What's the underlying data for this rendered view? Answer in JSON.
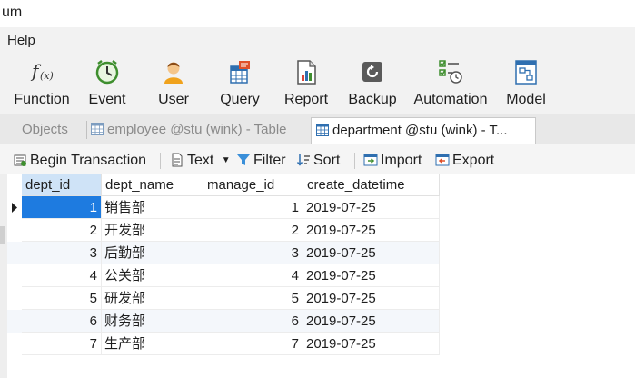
{
  "window": {
    "title": "um"
  },
  "menu": {
    "help": "Help"
  },
  "ribbon": [
    {
      "id": "function",
      "label": "Function",
      "icon": "function-icon"
    },
    {
      "id": "event",
      "label": "Event",
      "icon": "clock-icon"
    },
    {
      "id": "user",
      "label": "User",
      "icon": "user-icon"
    },
    {
      "id": "query",
      "label": "Query",
      "icon": "query-table-icon"
    },
    {
      "id": "report",
      "label": "Report",
      "icon": "report-icon"
    },
    {
      "id": "backup",
      "label": "Backup",
      "icon": "backup-icon"
    },
    {
      "id": "automation",
      "label": "Automation",
      "icon": "checklist-clock-icon"
    },
    {
      "id": "model",
      "label": "Model",
      "icon": "model-icon"
    }
  ],
  "tabs": [
    {
      "label": "Objects",
      "active": false
    },
    {
      "label": "employee @stu (wink) - Table",
      "active": false
    },
    {
      "label": "department @stu (wink) - T...",
      "active": true
    }
  ],
  "toolbar": {
    "begin_transaction": "Begin Transaction",
    "text": "Text",
    "filter": "Filter",
    "sort": "Sort",
    "import": "Import",
    "export": "Export"
  },
  "table": {
    "columns": [
      "dept_id",
      "dept_name",
      "manage_id",
      "create_datetime"
    ],
    "rows": [
      {
        "dept_id": "1",
        "dept_name": "销售部",
        "manage_id": "1",
        "create_datetime": "2019-07-25"
      },
      {
        "dept_id": "2",
        "dept_name": "开发部",
        "manage_id": "2",
        "create_datetime": "2019-07-25"
      },
      {
        "dept_id": "3",
        "dept_name": "后勤部",
        "manage_id": "3",
        "create_datetime": "2019-07-25"
      },
      {
        "dept_id": "4",
        "dept_name": "公关部",
        "manage_id": "4",
        "create_datetime": "2019-07-25"
      },
      {
        "dept_id": "5",
        "dept_name": "研发部",
        "manage_id": "5",
        "create_datetime": "2019-07-25"
      },
      {
        "dept_id": "6",
        "dept_name": "财务部",
        "manage_id": "6",
        "create_datetime": "2019-07-25"
      },
      {
        "dept_id": "7",
        "dept_name": "生产部",
        "manage_id": "7",
        "create_datetime": "2019-07-25"
      }
    ],
    "selected_row": 1
  },
  "colors": {
    "selected_cell": "#1e7be0",
    "header_selected": "#cfe3f7",
    "alt_row": "#f4f7fb",
    "accent": "#3a7fc1"
  }
}
